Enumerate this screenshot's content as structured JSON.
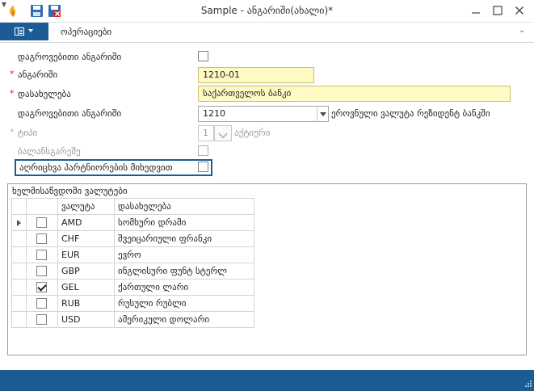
{
  "window": {
    "title": "Sample - ანგარიში(ახალი)*",
    "app_icon": "app-logo-icon",
    "quick_access": [
      "save-icon",
      "save-close-icon",
      "customize-dropdown-icon"
    ],
    "controls": [
      "minimize-icon",
      "maximize-icon",
      "close-icon"
    ]
  },
  "ribbon": {
    "menu_icon": "file-menu-icon",
    "tab_label": "ოპერაციები",
    "collapse_symbol": "⌄"
  },
  "form": {
    "grouped_account": {
      "label": "დაგროვებითი ანგარიში",
      "checked": false
    },
    "account": {
      "label": "ანგარიში",
      "required_mark": "*",
      "value": "1210-01"
    },
    "name": {
      "label": "დასახელება",
      "required_mark": "*",
      "value": "საქართველოს ბანკი"
    },
    "parent_account": {
      "label": "დაგროვებითი ანგარიში",
      "value": "1210",
      "description": "ეროვნული ვალუტა რეზიდენტ ბანკში"
    },
    "type": {
      "label": "ტიპი",
      "required_mark": "*",
      "value": "1",
      "description": "აქტიური"
    },
    "off_balance": {
      "label": "ბალანსგარეშე",
      "checked": false
    },
    "partner_tracking": {
      "label": "აღრიცხვა პარტნიორების მიხედვით",
      "checked": false
    }
  },
  "currencies": {
    "title": "ხელმისაწვდომი ვალუტები",
    "columns": [
      "ვალუტა",
      "დასახელება"
    ],
    "rows": [
      {
        "code": "AMD",
        "name": "სომხური დრამი",
        "checked": false,
        "current": true
      },
      {
        "code": "CHF",
        "name": "შვეიცარიული ფრანკი",
        "checked": false,
        "current": false
      },
      {
        "code": "EUR",
        "name": "ევრო",
        "checked": false,
        "current": false
      },
      {
        "code": "GBP",
        "name": "ინგლისური ფუნტ სტერლ",
        "checked": false,
        "current": false
      },
      {
        "code": "GEL",
        "name": "ქართული ლარი",
        "checked": true,
        "current": false
      },
      {
        "code": "RUB",
        "name": "რუსული რუბლი",
        "checked": false,
        "current": false
      },
      {
        "code": "USD",
        "name": "ამერიკული დოლარი",
        "checked": false,
        "current": false
      }
    ]
  },
  "colors": {
    "accent": "#1c5c96",
    "required": "#d9261c",
    "input_highlight": "#fff9c4"
  }
}
